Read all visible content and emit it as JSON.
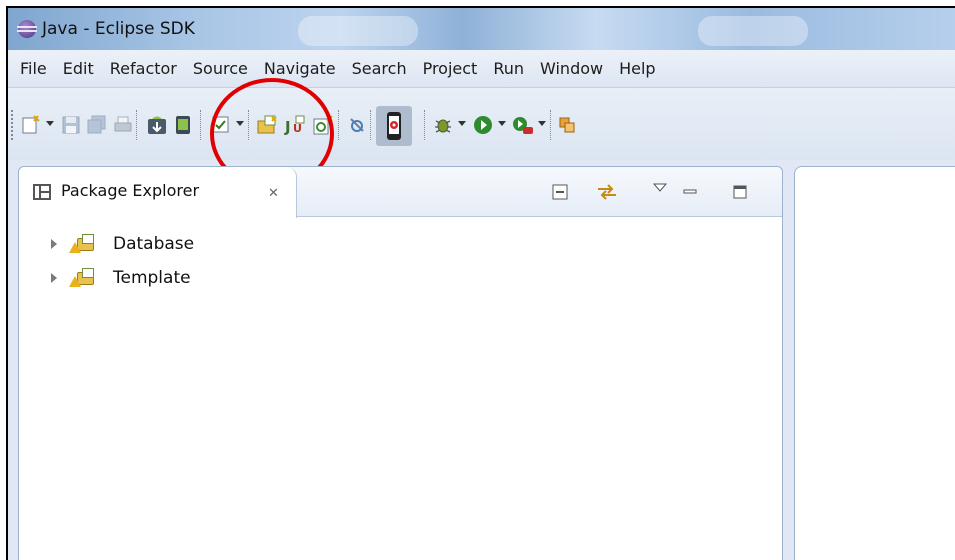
{
  "window": {
    "title": "Java - Eclipse SDK"
  },
  "menu": [
    "File",
    "Edit",
    "Refactor",
    "Source",
    "Navigate",
    "Search",
    "Project",
    "Run",
    "Window",
    "Help"
  ],
  "toolbar": {
    "icons": {
      "new": "new-file-icon",
      "save": "save-icon",
      "save_all": "save-all-icon",
      "print": "print-icon",
      "sdk_manager": "android-sdk-manager-icon",
      "avd_manager": "android-avd-manager-icon",
      "check": "checkbox-icon",
      "new_project": "new-java-project-icon",
      "junit": "new-junit-icon",
      "new_class": "new-class-icon",
      "toggle_mark": "toggle-mark-occurrences-icon",
      "device": "android-device-icon",
      "debug": "debug-icon",
      "run": "run-icon",
      "external_tools": "external-tools-icon",
      "open_type": "open-type-icon"
    },
    "highlight_color": "#e00000"
  },
  "package_explorer": {
    "tab_label": "Package Explorer",
    "projects": [
      {
        "label": "Database"
      },
      {
        "label": "Template"
      }
    ]
  }
}
